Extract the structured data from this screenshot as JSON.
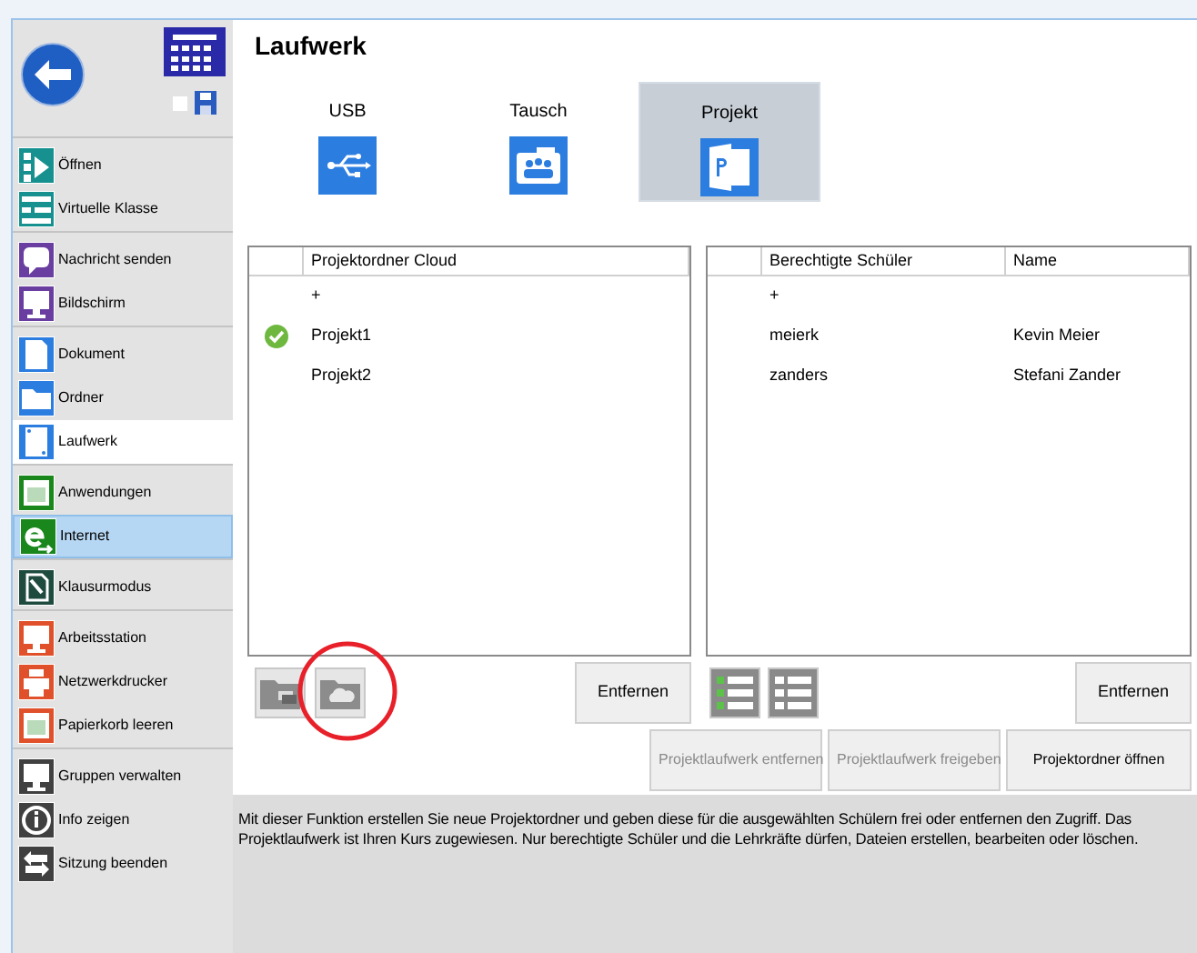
{
  "sidebar": {
    "groups": [
      {
        "color": "#17918f",
        "items": [
          {
            "label": "Öffnen",
            "kind": "play",
            "selected": false,
            "highlighted": false
          },
          {
            "label": "Virtuelle Klasse",
            "kind": "grid",
            "selected": false,
            "highlighted": false
          }
        ]
      },
      {
        "color": "#6a3ea1",
        "items": [
          {
            "label": "Nachricht senden",
            "kind": "chat",
            "selected": false,
            "highlighted": false
          },
          {
            "label": "Bildschirm",
            "kind": "monitor",
            "selected": false,
            "highlighted": false
          }
        ]
      },
      {
        "color": "#2b7de0",
        "items": [
          {
            "label": "Dokument",
            "kind": "doc",
            "selected": false,
            "highlighted": false
          },
          {
            "label": "Ordner",
            "kind": "folder",
            "selected": false,
            "highlighted": false
          },
          {
            "label": "Laufwerk",
            "kind": "drive",
            "selected": true,
            "highlighted": false
          }
        ]
      },
      {
        "color": "#19871c",
        "items": [
          {
            "label": "Anwendungen",
            "kind": "window",
            "selected": false,
            "highlighted": false
          },
          {
            "label": "Internet",
            "kind": "web",
            "selected": false,
            "highlighted": true
          }
        ]
      },
      {
        "color": "#1f4b3f",
        "items": [
          {
            "label": "Klausurmodus",
            "kind": "pen",
            "selected": false,
            "highlighted": false
          }
        ]
      },
      {
        "color": "#e0512b",
        "items": [
          {
            "label": "Arbeitsstation",
            "kind": "monitor",
            "selected": false,
            "highlighted": false
          },
          {
            "label": "Netzwerkdrucker",
            "kind": "printer",
            "selected": false,
            "highlighted": false
          },
          {
            "label": "Papierkorb leeren",
            "kind": "window",
            "selected": false,
            "highlighted": false
          }
        ]
      },
      {
        "color": "#404040",
        "items": [
          {
            "label": "Gruppen verwalten",
            "kind": "monitor",
            "selected": false,
            "highlighted": false
          },
          {
            "label": "Info zeigen",
            "kind": "info",
            "selected": false,
            "highlighted": false
          },
          {
            "label": "Sitzung beenden",
            "kind": "swap",
            "selected": false,
            "highlighted": false
          }
        ]
      }
    ]
  },
  "save_checkbox": {
    "checked": false
  },
  "title": "Laufwerk",
  "tabs": [
    {
      "label": "USB",
      "kind": "usb",
      "selected": false
    },
    {
      "label": "Tausch",
      "kind": "share",
      "selected": false
    },
    {
      "label": "Projekt",
      "kind": "project",
      "selected": true
    }
  ],
  "folders_table": {
    "columns": [
      "Projektordner Cloud"
    ],
    "rows": [
      {
        "name": "+",
        "ok": false
      },
      {
        "name": "Projekt1",
        "ok": true
      },
      {
        "name": "Projekt2",
        "ok": false
      }
    ]
  },
  "students_table": {
    "columns": [
      "Berechtigte Schüler",
      "Name"
    ],
    "rows": [
      {
        "cells": [
          "+",
          ""
        ]
      },
      {
        "cells": [
          "meierk",
          "Kevin Meier"
        ]
      },
      {
        "cells": [
          "zanders",
          "Stefani Zander"
        ]
      }
    ]
  },
  "left_remove": "Entfernen",
  "right_remove": "Entfernen",
  "actions": [
    {
      "label": "Projektlaufwerk entfernen",
      "disabled": true
    },
    {
      "label": "Projektlaufwerk freigeben",
      "disabled": true
    },
    {
      "label": "Projektordner öffnen",
      "disabled": false
    }
  ],
  "description": "Mit dieser Funktion erstellen Sie neue Projektordner und geben diese für die ausgewählten Schülern frei oder entfernen den Zugriff. Das Projektlaufwerk ist Ihren Kurs zugewiesen. Nur berechtigte Schüler und die Lehrkräfte dürfen, Dateien erstellen, bearbeiten oder löschen."
}
